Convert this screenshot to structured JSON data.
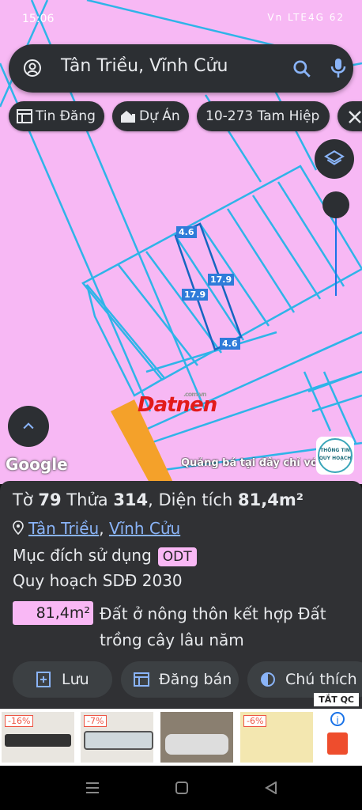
{
  "status": {
    "time": "15:06",
    "right": "Vn LTE4G 62"
  },
  "search": {
    "query": "Tân Triều, Vĩnh Cửu"
  },
  "chips": [
    {
      "label": "Tin Đăng",
      "icon": "listing-icon"
    },
    {
      "label": "Dự Án",
      "icon": "building-icon"
    },
    {
      "label": "10-273 Tam Hiệp",
      "icon": ""
    },
    {
      "label": "",
      "icon": "tools-icon"
    }
  ],
  "map": {
    "dims": [
      "4.6",
      "17.9",
      "17.9",
      "4.6"
    ],
    "watermark": "Datnen",
    "watermark_domain": ".com.vn",
    "google": "Google",
    "promo": "Quảng bá tại đây chỉ với",
    "badge_top": "THÔNG TIN",
    "badge_bottom": "QUY HOẠCH"
  },
  "parcel": {
    "to_label": "Tờ",
    "to": "79",
    "thua_label": "Thửa",
    "thua": "314",
    "area_label": "Diện tích",
    "area": "81,4m²",
    "commune": "Tân Triều",
    "district": "Vĩnh Cửu",
    "purpose_label": "Mục đích sử dụng",
    "purpose_code": "ODT",
    "plan": "Quy hoạch SDĐ 2030",
    "plan_area": "81,4m²",
    "plan_desc": "Đất ở nông thôn kết hợp Đất trồng cây lâu năm"
  },
  "actions": {
    "save": "Lưu",
    "post": "Đăng bán",
    "legend": "Chú thích"
  },
  "ads": {
    "close": "TẮT QC",
    "items": [
      {
        "discount": "-16%"
      },
      {
        "discount": "-7%"
      },
      {
        "discount": ""
      },
      {
        "discount": "-6%"
      }
    ]
  },
  "colors": {
    "map_bg": "#f7b8f4",
    "parcel_line": "#2fb4e8",
    "accent": "#1a73e8",
    "sheet_bg": "#303134"
  }
}
